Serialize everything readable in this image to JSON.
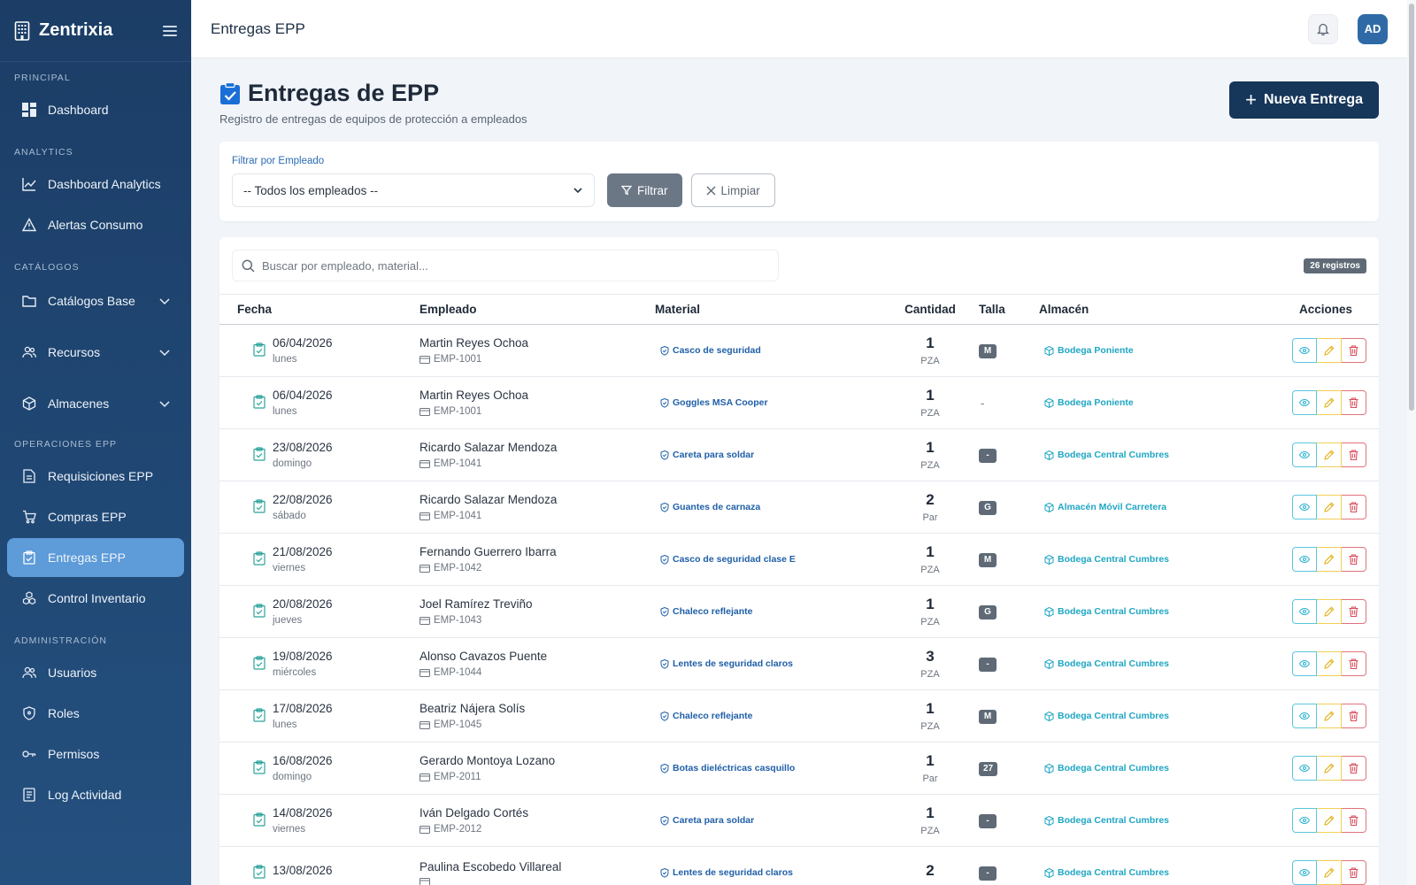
{
  "app": {
    "name": "Zentrixia"
  },
  "sidebar": {
    "sections": [
      {
        "label": "PRINCIPAL",
        "items": [
          {
            "label": "Dashboard",
            "icon": "dashboard-icon"
          }
        ]
      },
      {
        "label": "ANALYTICS",
        "items": [
          {
            "label": "Dashboard Analytics",
            "icon": "chart-line-icon"
          },
          {
            "label": "Alertas Consumo",
            "icon": "warning-icon"
          }
        ]
      },
      {
        "label": "CATÁLOGOS",
        "items": [
          {
            "label": "Catálogos Base",
            "icon": "folder-icon",
            "expandable": true
          },
          {
            "label": "Recursos",
            "icon": "users-icon",
            "expandable": true
          },
          {
            "label": "Almacenes",
            "icon": "box-icon",
            "expandable": true
          }
        ]
      },
      {
        "label": "OPERACIONES EPP",
        "items": [
          {
            "label": "Requisiciones EPP",
            "icon": "document-icon"
          },
          {
            "label": "Compras EPP",
            "icon": "cart-icon"
          },
          {
            "label": "Entregas EPP",
            "icon": "clipboard-check-icon",
            "active": true
          },
          {
            "label": "Control Inventario",
            "icon": "boxes-icon"
          }
        ]
      },
      {
        "label": "ADMINISTRACIÓN",
        "items": [
          {
            "label": "Usuarios",
            "icon": "users-icon"
          },
          {
            "label": "Roles",
            "icon": "shield-icon"
          },
          {
            "label": "Permisos",
            "icon": "key-icon"
          },
          {
            "label": "Log Actividad",
            "icon": "log-icon"
          }
        ]
      }
    ]
  },
  "topbar": {
    "title": "Entregas EPP",
    "avatar_initials": "AD"
  },
  "page": {
    "title": "Entregas de EPP",
    "subtitle": "Registro de entregas de equipos de protección a empleados",
    "new_button": "Nueva Entrega"
  },
  "filter": {
    "label": "Filtrar por Empleado",
    "selected": "-- Todos los empleados --",
    "filter_button": "Filtrar",
    "clear_button": "Limpiar"
  },
  "table": {
    "search_placeholder": "Buscar por empleado, material...",
    "count_label": "26 registros",
    "columns": {
      "fecha": "Fecha",
      "empleado": "Empleado",
      "material": "Material",
      "cantidad": "Cantidad",
      "talla": "Talla",
      "almacen": "Almacén",
      "acciones": "Acciones"
    },
    "rows": [
      {
        "date": "06/04/2026",
        "weekday": "lunes",
        "employee": "Martin Reyes Ochoa",
        "emp_id": "EMP-1001",
        "material": "Casco de seguridad",
        "qty": "1",
        "unit": "PZA",
        "size": "M",
        "warehouse": "Bodega Poniente"
      },
      {
        "date": "06/04/2026",
        "weekday": "lunes",
        "employee": "Martin Reyes Ochoa",
        "emp_id": "EMP-1001",
        "material": "Goggles MSA Cooper",
        "qty": "1",
        "unit": "PZA",
        "size": "",
        "warehouse": "Bodega Poniente"
      },
      {
        "date": "23/08/2026",
        "weekday": "domingo",
        "employee": "Ricardo Salazar Mendoza",
        "emp_id": "EMP-1041",
        "material": "Careta para soldar",
        "qty": "1",
        "unit": "PZA",
        "size": "-",
        "warehouse": "Bodega Central Cumbres"
      },
      {
        "date": "22/08/2026",
        "weekday": "sábado",
        "employee": "Ricardo Salazar Mendoza",
        "emp_id": "EMP-1041",
        "material": "Guantes de carnaza",
        "qty": "2",
        "unit": "Par",
        "size": "G",
        "warehouse": "Almacén Móvil Carretera"
      },
      {
        "date": "21/08/2026",
        "weekday": "viernes",
        "employee": "Fernando Guerrero Ibarra",
        "emp_id": "EMP-1042",
        "material": "Casco de seguridad clase E",
        "qty": "1",
        "unit": "PZA",
        "size": "M",
        "warehouse": "Bodega Central Cumbres"
      },
      {
        "date": "20/08/2026",
        "weekday": "jueves",
        "employee": "Joel Ramírez Treviño",
        "emp_id": "EMP-1043",
        "material": "Chaleco reflejante",
        "qty": "1",
        "unit": "PZA",
        "size": "G",
        "warehouse": "Bodega Central Cumbres"
      },
      {
        "date": "19/08/2026",
        "weekday": "miércoles",
        "employee": "Alonso Cavazos Puente",
        "emp_id": "EMP-1044",
        "material": "Lentes de seguridad claros",
        "qty": "3",
        "unit": "PZA",
        "size": "-",
        "warehouse": "Bodega Central Cumbres"
      },
      {
        "date": "17/08/2026",
        "weekday": "lunes",
        "employee": "Beatriz Nájera Solís",
        "emp_id": "EMP-1045",
        "material": "Chaleco reflejante",
        "qty": "1",
        "unit": "PZA",
        "size": "M",
        "warehouse": "Bodega Central Cumbres"
      },
      {
        "date": "16/08/2026",
        "weekday": "domingo",
        "employee": "Gerardo Montoya Lozano",
        "emp_id": "EMP-2011",
        "material": "Botas dieléctricas casquillo",
        "qty": "1",
        "unit": "Par",
        "size": "27",
        "warehouse": "Bodega Central Cumbres"
      },
      {
        "date": "14/08/2026",
        "weekday": "viernes",
        "employee": "Iván Delgado Cortés",
        "emp_id": "EMP-2012",
        "material": "Careta para soldar",
        "qty": "1",
        "unit": "PZA",
        "size": "-",
        "warehouse": "Bodega Central Cumbres"
      },
      {
        "date": "13/08/2026",
        "weekday": "",
        "employee": "Paulina Escobedo Villareal",
        "emp_id": "",
        "material": "Lentes de seguridad claros",
        "qty": "2",
        "unit": "",
        "size": "-",
        "warehouse": "Bodega Central Cumbres"
      }
    ]
  },
  "colors": {
    "sidebar_top": "#1b3d66",
    "sidebar_bottom": "#24507f",
    "active_nav": "#5d9bd9",
    "primary_button": "#16365a",
    "material_link": "#1f5fa8",
    "warehouse_link": "#1fa6c4"
  }
}
